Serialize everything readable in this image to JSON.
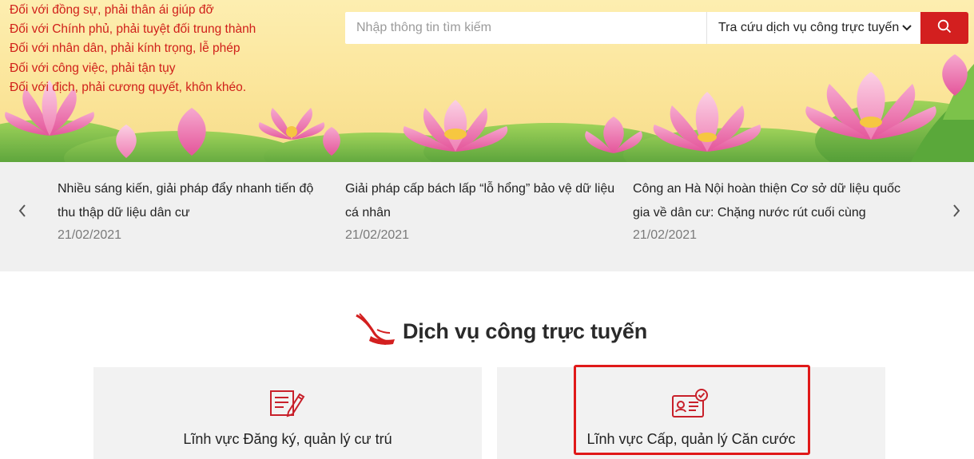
{
  "banner": {
    "motto": [
      "Đối với đồng sự, phải thân ái giúp đỡ",
      "Đối với Chính phủ, phải tuyệt đối trung thành",
      "Đối với nhân dân, phải kính trọng, lễ phép",
      "Đối với công việc, phải tận tụy",
      "Đối với địch, phải cương quyết, khôn khéo."
    ],
    "art": "lotus-flowers-banner"
  },
  "search": {
    "placeholder": "Nhập thông tin tìm kiếm",
    "value": "",
    "category_selected": "Tra cứu dịch vụ công trực tuyến",
    "button_icon": "search-icon"
  },
  "news": {
    "prev_icon": "chevron-left-icon",
    "next_icon": "chevron-right-icon",
    "items": [
      {
        "title": "Nhiều sáng kiến, giải pháp đẩy nhanh tiến độ thu thập dữ liệu dân cư",
        "date": "21/02/2021"
      },
      {
        "title": "Giải pháp cấp bách lấp “lỗ hổng” bảo vệ dữ liệu cá nhân",
        "date": "21/02/2021"
      },
      {
        "title": "Công an Hà Nội hoàn thiện Cơ sở dữ liệu quốc gia về dân cư: Chặng nước rút cuối cùng",
        "date": "21/02/2021"
      }
    ]
  },
  "services": {
    "title": "Dịch vụ công trực tuyến",
    "title_icon": "emblem-icon",
    "cards": [
      {
        "label": "Lĩnh vực Đăng ký, quản lý cư trú",
        "icon": "registration-form-icon"
      },
      {
        "label": "Lĩnh vực Cấp, quản lý Căn cước",
        "icon": "id-card-check-icon",
        "highlighted": true
      }
    ]
  },
  "colors": {
    "accent_red": "#d31f1f",
    "motto_red": "#d0201a",
    "banner_yellow": "#fbe59a",
    "news_bg": "#f0f0f0",
    "card_bg": "#f2f2f2",
    "highlight_border": "#e01919"
  }
}
